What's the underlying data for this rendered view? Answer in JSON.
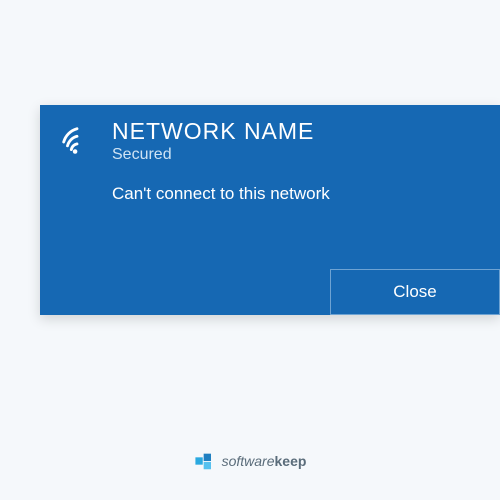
{
  "network": {
    "name": "NETWORK NAME",
    "status": "Secured",
    "error_message": "Can't connect to this network"
  },
  "buttons": {
    "close": "Close"
  },
  "brand": {
    "name_light": "software",
    "name_bold": "keep"
  },
  "colors": {
    "panel": "#1668b3",
    "button_border": "#6ea3d3",
    "background": "#f5f8fb"
  }
}
